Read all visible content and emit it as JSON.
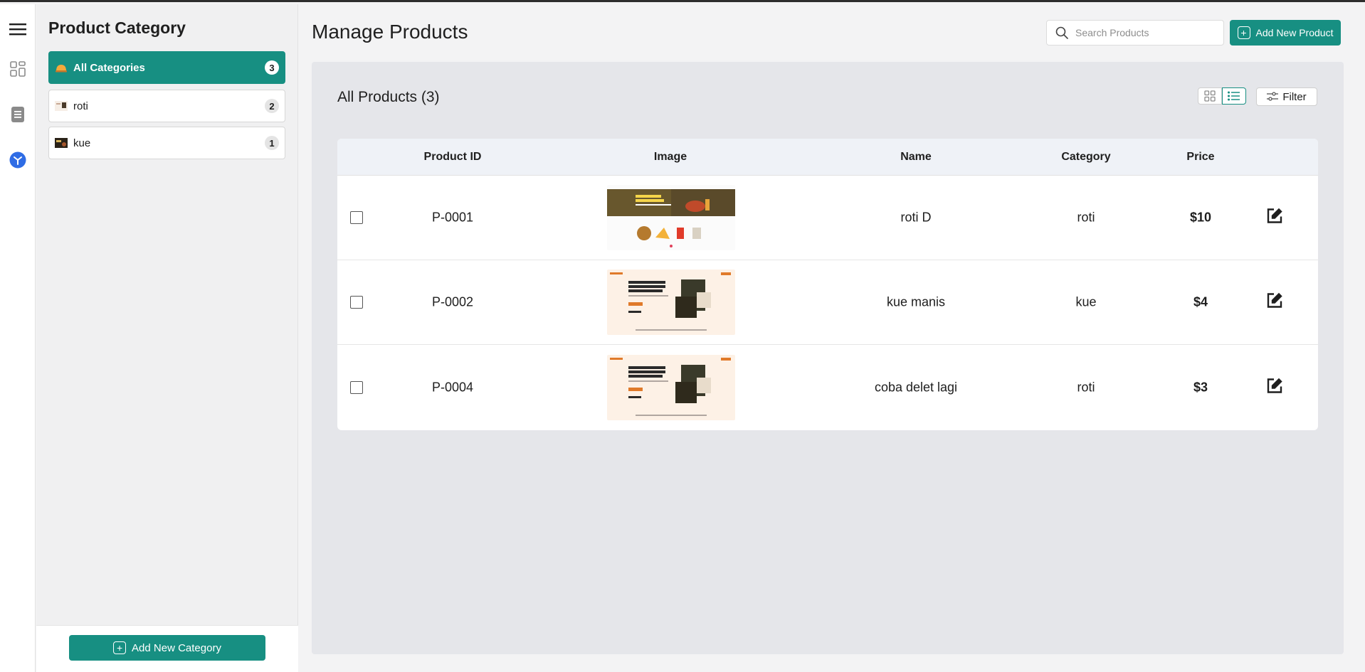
{
  "sidebar": {
    "category_title": "Product Category",
    "categories": [
      {
        "label": "All Categories",
        "count": "3",
        "icon": "bread-icon"
      },
      {
        "label": "roti",
        "count": "2",
        "icon": "thumbnail-icon"
      },
      {
        "label": "kue",
        "count": "1",
        "icon": "thumbnail-icon"
      }
    ],
    "add_category_label": "Add New Category"
  },
  "header": {
    "title": "Manage Products",
    "search_placeholder": "Search Products",
    "add_product_label": "Add New Product"
  },
  "products_panel": {
    "title": "All Products (3)",
    "filter_label": "Filter"
  },
  "table": {
    "columns": [
      "Product ID",
      "Image",
      "Name",
      "Category",
      "Price"
    ],
    "rows": [
      {
        "id": "P-0001",
        "name": "roti D",
        "category": "roti",
        "price": "$10",
        "image": "food-landing-dark"
      },
      {
        "id": "P-0002",
        "name": "kue manis",
        "category": "kue",
        "price": "$4",
        "image": "food-landing-light"
      },
      {
        "id": "P-0004",
        "name": "coba delet lagi",
        "category": "roti",
        "price": "$3",
        "image": "food-landing-light"
      }
    ]
  },
  "colors": {
    "accent": "#178f82",
    "panel_bg": "#e5e6ea",
    "header_bg": "#eff2f7"
  }
}
